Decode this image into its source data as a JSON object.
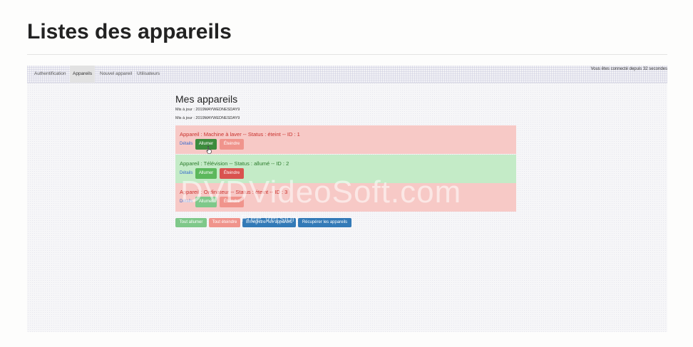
{
  "page": {
    "title": "Listes des appareils"
  },
  "nav": {
    "items": [
      "Authentification",
      "Appareils",
      "Nouvel appareil",
      "Utilisateurs"
    ],
    "active_index": 1,
    "status": "Vous êtes connecté depuis 32 secondes"
  },
  "content": {
    "title": "Mes appareils",
    "updated_lines": [
      "Mis à jour : 2019MAYWEDNESDAY9",
      "Mis à jour : 2019MAYWEDNESDAY9"
    ]
  },
  "devices": [
    {
      "label": "Appareil : Machine à laver -- Status : éteint -- ID : 1",
      "status": "éteint",
      "details": "Détails",
      "on_label": "Allumer",
      "off_label": "Éteindre"
    },
    {
      "label": "Appareil : Télévision -- Status : allumé -- ID : 2",
      "status": "allumé",
      "details": "Détails",
      "on_label": "Allumer",
      "off_label": "Éteindre"
    },
    {
      "label": "Appareil : Ordinateur -- Status : éteint -- ID : 3",
      "status": "éteint",
      "details": "Détails",
      "on_label": "Allumer",
      "off_label": "Éteindre"
    }
  ],
  "footer": {
    "all_on": "Tout allumer",
    "all_off": "Tout éteindre",
    "save": "Enregistrer les appareils",
    "fetch": "Récupérer les appareils"
  },
  "watermark": {
    "main": "DVDVideoSoft.com",
    "sub": "Free Version"
  },
  "colors": {
    "off_bg": "#f7c9c6",
    "on_bg": "#c4ebc7",
    "btn_green": "#5cb85c",
    "btn_red": "#d9534f",
    "btn_blue": "#337ab7"
  }
}
